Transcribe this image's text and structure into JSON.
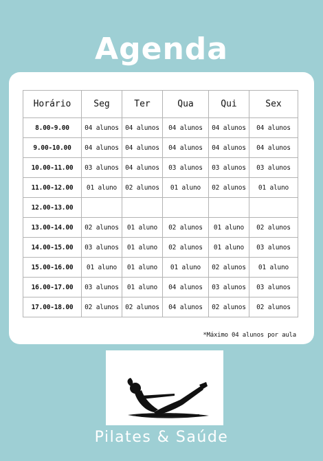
{
  "title": "Agenda",
  "headers": [
    "Horário",
    "Seg",
    "Ter",
    "Qua",
    "Qui",
    "Sex"
  ],
  "rows": [
    {
      "time": "8.00-9.00",
      "days": [
        "04 alunos",
        "04 alunos",
        "04 alunos",
        "04 alunos",
        "04 alunos"
      ]
    },
    {
      "time": "9.00-10.00",
      "days": [
        "04 alunos",
        "04 alunos",
        "04 alunos",
        "04 alunos",
        "04 alunos"
      ]
    },
    {
      "time": "10.00-11.00",
      "days": [
        "03 alunos",
        "04 alunos",
        "03 alunos",
        "03 alunos",
        "03 alunos"
      ]
    },
    {
      "time": "11.00-12.00",
      "days": [
        "01 aluno",
        "02 alunos",
        "01 aluno",
        "02 alunos",
        "01 aluno"
      ]
    },
    {
      "time": "12.00-13.00",
      "days": [
        "",
        "",
        "",
        "",
        ""
      ]
    },
    {
      "time": "13.00-14.00",
      "days": [
        "02 alunos",
        "01 aluno",
        "02 alunos",
        "01 aluno",
        "02 alunos"
      ]
    },
    {
      "time": "14.00-15.00",
      "days": [
        "03 alunos",
        "01 aluno",
        "02 alunos",
        "01 aluno",
        "03 alunos"
      ]
    },
    {
      "time": "15.00-16.00",
      "days": [
        "01 aluno",
        "01 aluno",
        "01 aluno",
        "02 alunos",
        "01 aluno"
      ]
    },
    {
      "time": "16.00-17.00",
      "days": [
        "03 alunos",
        "01 aluno",
        "04 alunos",
        "03 alunos",
        "03 alunos"
      ]
    },
    {
      "time": "17.00-18.00",
      "days": [
        "02 alunos",
        "02 alunos",
        "04 alunos",
        "02 alunos",
        "02 alunos"
      ]
    }
  ],
  "note": "*Máximo 04 alunos por aula",
  "image_icon": "pilates-boat-pose-silhouette",
  "brand": "Pilates & Saúde",
  "colors": {
    "background": "#9ecfd4",
    "card": "#ffffff",
    "grid": "#b3b3b3",
    "text": "#111111"
  }
}
